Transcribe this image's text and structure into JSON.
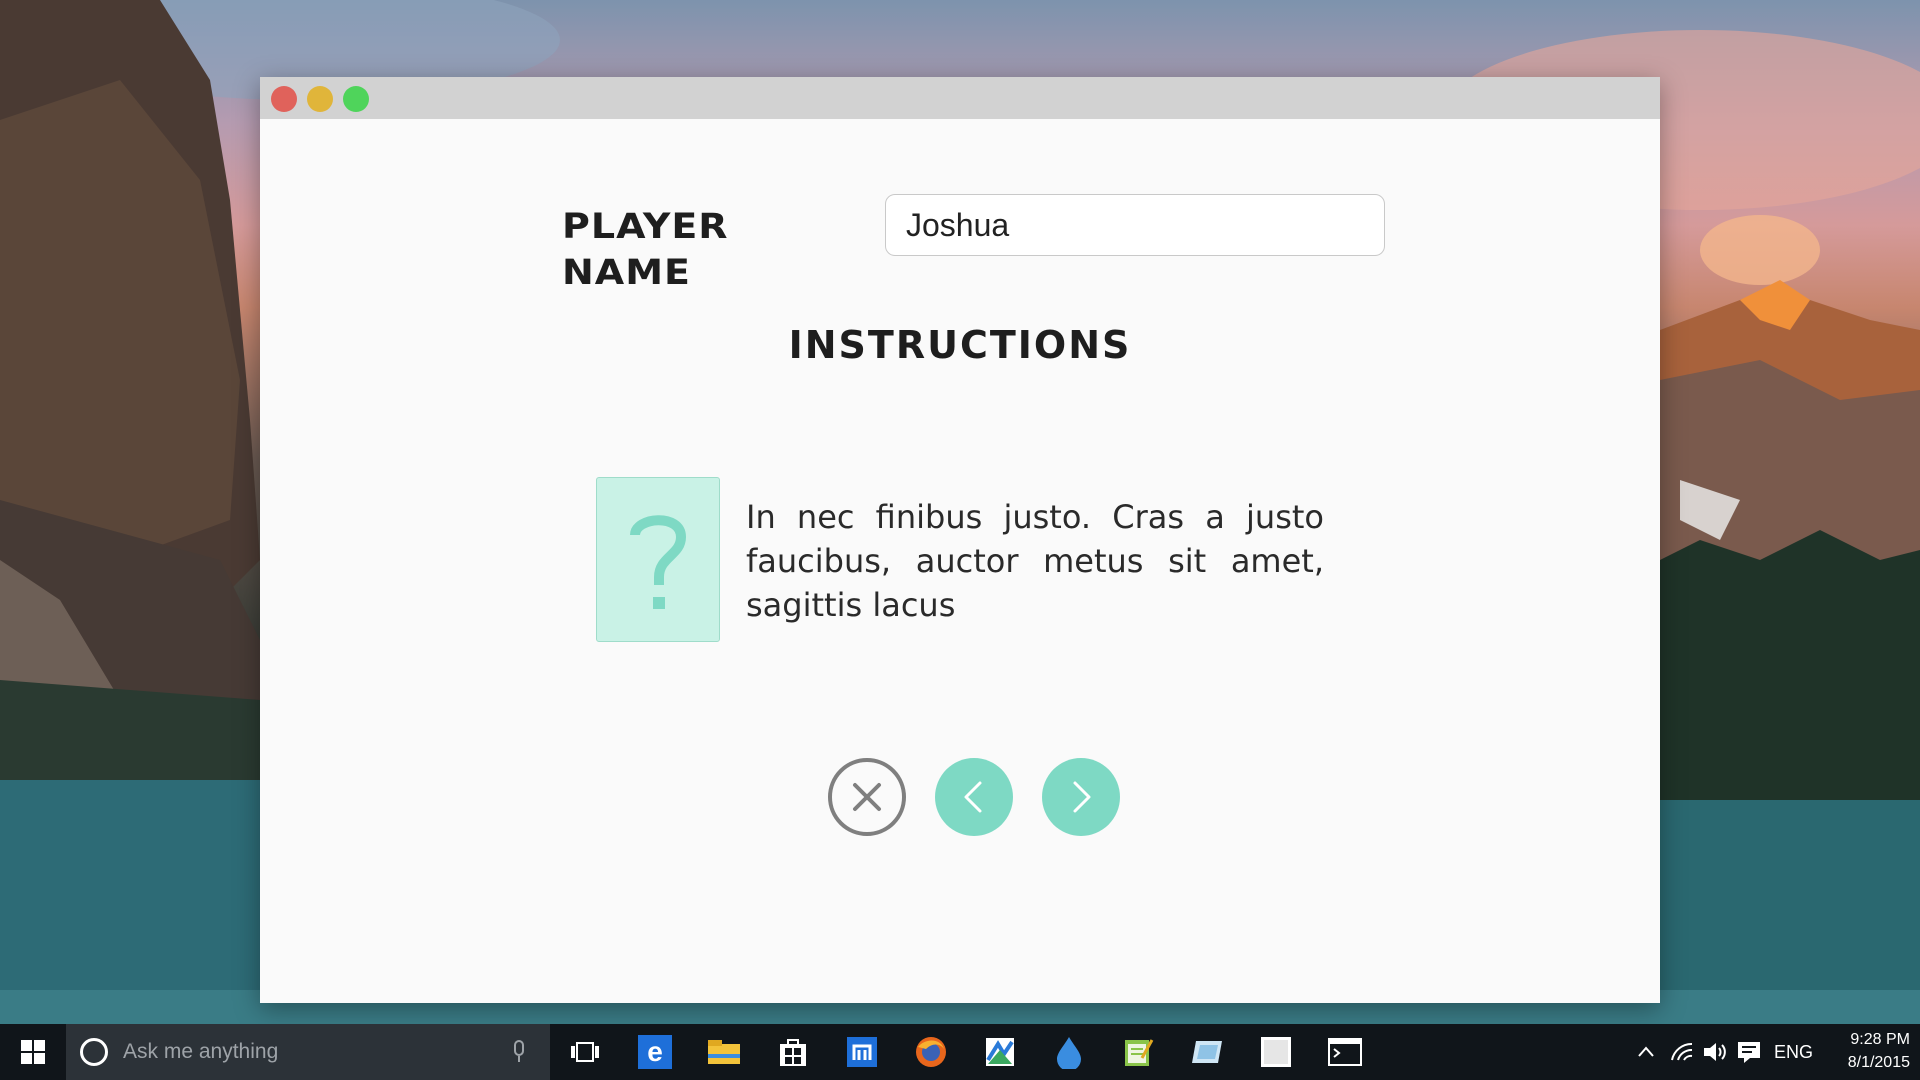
{
  "window": {
    "player_name_label": "Player Name",
    "player_name_value": "Joshua",
    "instructions_heading": "Instructions",
    "instruction_text": "In nec finibus justo. Cras a justo faucibus, auctor metus sit amet, sagittis lacus"
  },
  "taskbar": {
    "search_placeholder": "Ask me anything",
    "language": "ENG",
    "time": "9:28 PM",
    "date": "8/1/2015"
  },
  "colors": {
    "accent_teal": "#7ed9c4",
    "tile_bg": "#c9f2e6",
    "close_red": "#e0625b",
    "minimize_yellow": "#e0b53a",
    "maximize_green": "#4fd45b"
  },
  "icons": {
    "help": "question-mark-icon",
    "close": "x-icon",
    "prev": "chevron-left-icon",
    "next": "chevron-right-icon"
  }
}
